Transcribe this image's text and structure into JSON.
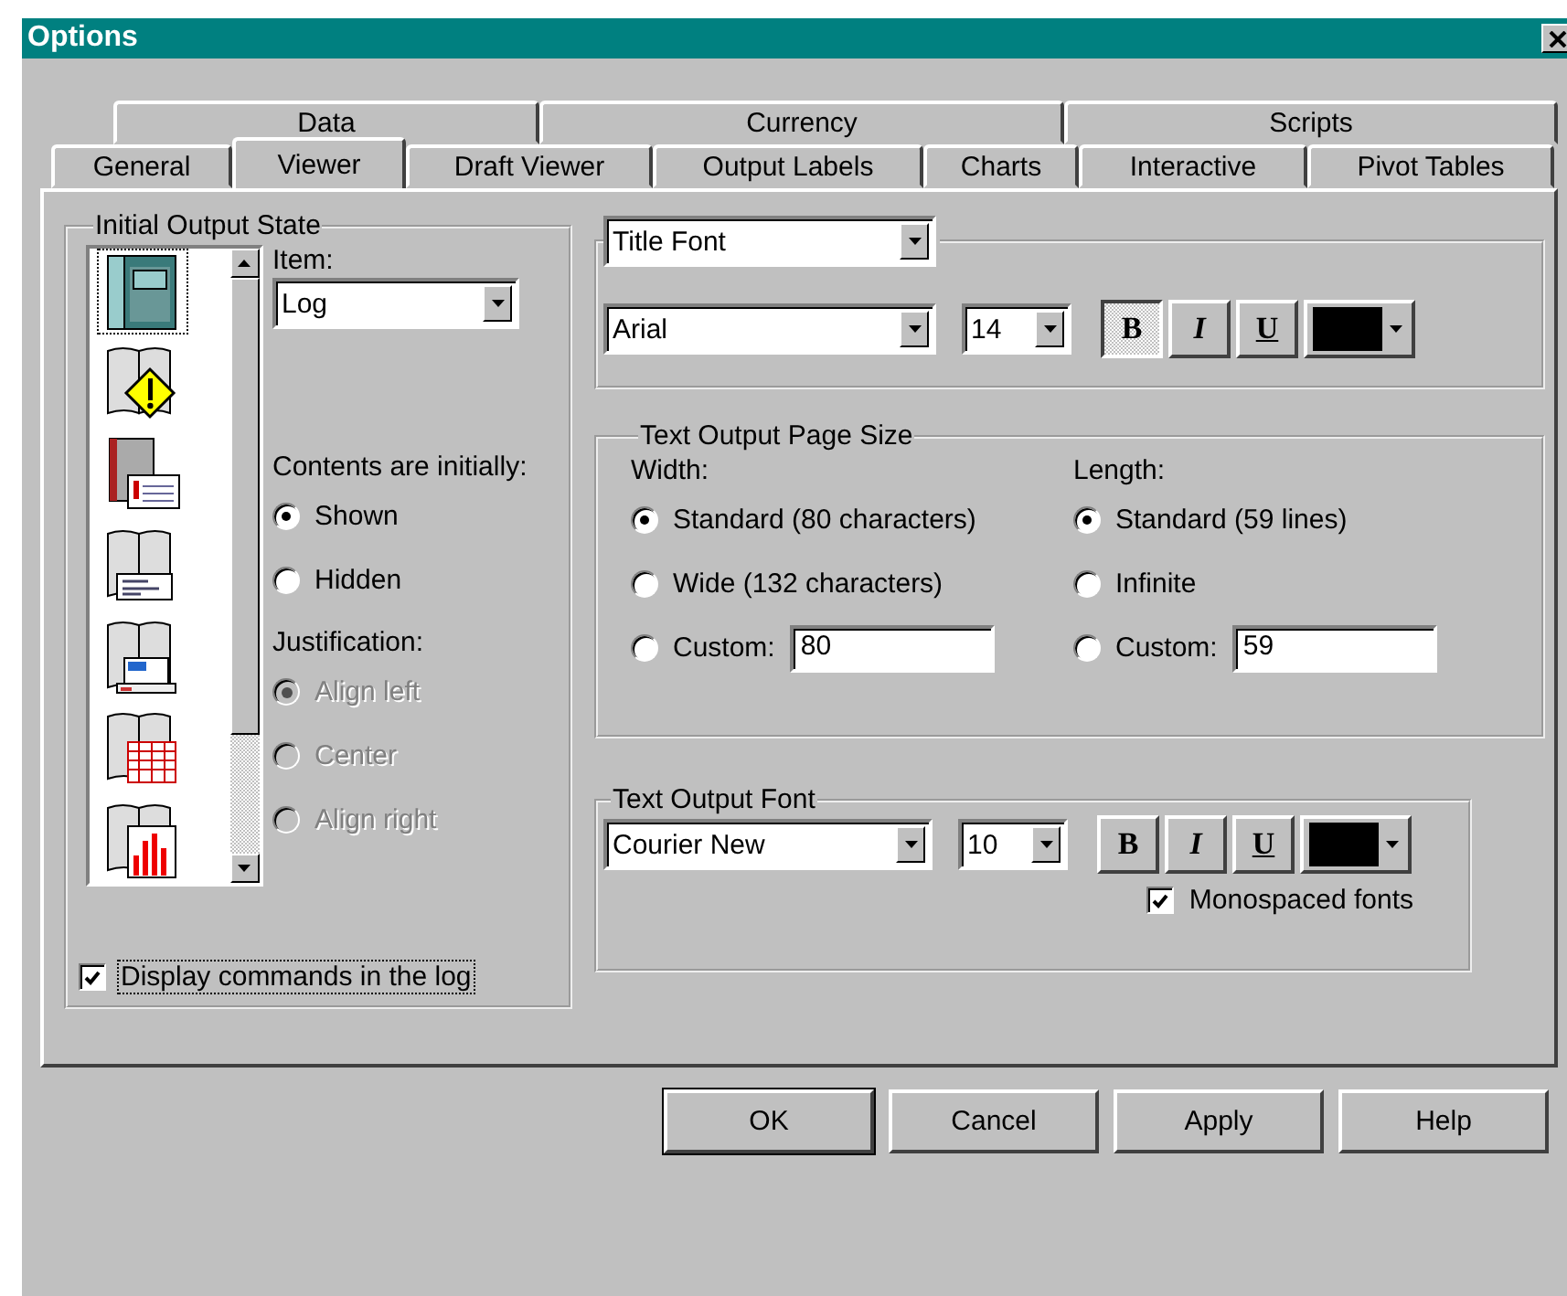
{
  "window": {
    "title": "Options"
  },
  "tab_rows": [
    [
      {
        "label": "Data",
        "selected": false
      },
      {
        "label": "Currency",
        "selected": false
      },
      {
        "label": "Scripts",
        "selected": false
      }
    ],
    [
      {
        "label": "General",
        "selected": false
      },
      {
        "label": "Viewer",
        "selected": true
      },
      {
        "label": "Draft Viewer",
        "selected": false
      },
      {
        "label": "Output Labels",
        "selected": false
      },
      {
        "label": "Charts",
        "selected": false
      },
      {
        "label": "Interactive",
        "selected": false
      },
      {
        "label": "Pivot Tables",
        "selected": false
      }
    ]
  ],
  "initial_output_state": {
    "title": "Initial Output State",
    "item_icons": [
      {
        "kind": "log",
        "selected": true
      },
      {
        "kind": "warning",
        "selected": false
      },
      {
        "kind": "notes",
        "selected": false
      },
      {
        "kind": "title",
        "selected": false
      },
      {
        "kind": "text",
        "selected": false
      },
      {
        "kind": "table",
        "selected": false
      },
      {
        "kind": "chart",
        "selected": false
      }
    ],
    "item_label": "Item:",
    "item_value": "Log",
    "contents_label": "Contents are initially:",
    "contents_options": [
      {
        "label": "Shown",
        "selected": true
      },
      {
        "label": "Hidden",
        "selected": false
      }
    ],
    "justification_label": "Justification:",
    "justification_options": [
      {
        "label": "Align left",
        "selected": true,
        "disabled": true
      },
      {
        "label": "Center",
        "selected": false,
        "disabled": true
      },
      {
        "label": "Align right",
        "selected": false,
        "disabled": true
      }
    ],
    "display_commands": {
      "label": "Display commands in the log",
      "checked": true
    }
  },
  "title_font": {
    "category": "Title Font",
    "font": "Arial",
    "size": "14",
    "styles": [
      {
        "kind": "bold",
        "label": "B",
        "on": true
      },
      {
        "kind": "italic",
        "label": "I",
        "on": false
      },
      {
        "kind": "underline",
        "label": "U",
        "on": false
      }
    ],
    "color": "#000000"
  },
  "page_size": {
    "title": "Text Output Page Size",
    "columns": [
      {
        "label": "Width:",
        "options": [
          {
            "label": "Standard (80 characters)",
            "selected": true
          },
          {
            "label": "Wide (132 characters)",
            "selected": false
          },
          {
            "label": "Custom:",
            "selected": false
          }
        ],
        "custom_value": "80"
      },
      {
        "label": "Length:",
        "options": [
          {
            "label": "Standard (59 lines)",
            "selected": true
          },
          {
            "label": "Infinite",
            "selected": false
          },
          {
            "label": "Custom:",
            "selected": false
          }
        ],
        "custom_value": "59"
      }
    ]
  },
  "text_font": {
    "title": "Text Output Font",
    "font": "Courier New",
    "size": "10",
    "styles": [
      {
        "kind": "bold",
        "label": "B",
        "on": false
      },
      {
        "kind": "italic",
        "label": "I",
        "on": false
      },
      {
        "kind": "underline",
        "label": "U",
        "on": false
      }
    ],
    "color": "#000000",
    "monospaced": {
      "label": "Monospaced fonts",
      "checked": true
    }
  },
  "buttons": [
    {
      "label": "OK",
      "default": true
    },
    {
      "label": "Cancel",
      "default": false
    },
    {
      "label": "Apply",
      "default": false
    },
    {
      "label": "Help",
      "default": false
    }
  ]
}
